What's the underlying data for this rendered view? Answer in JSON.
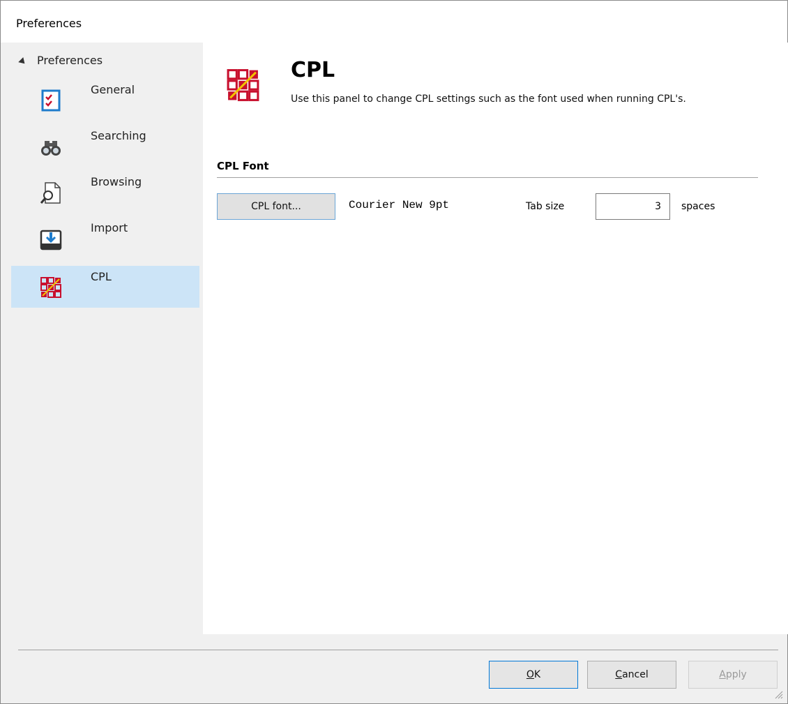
{
  "window": {
    "title": "Preferences"
  },
  "sidebar": {
    "root_label": "Preferences",
    "items": [
      {
        "label": "General",
        "icon": "checklist-icon"
      },
      {
        "label": "Searching",
        "icon": "binoculars-icon"
      },
      {
        "label": "Browsing",
        "icon": "document-magnifier-icon"
      },
      {
        "label": "Import",
        "icon": "import-tray-icon"
      },
      {
        "label": "CPL",
        "icon": "cpl-grid-icon",
        "selected": true
      }
    ]
  },
  "panel": {
    "title": "CPL",
    "description": "Use this panel to change CPL settings such as the font used when running CPL's.",
    "section_title": "CPL Font",
    "font_button_label": "CPL font...",
    "font_value": "Courier New 9pt",
    "tab_size_label": "Tab size",
    "tab_size_value": "3",
    "tab_size_unit": "spaces"
  },
  "footer": {
    "ok_mnemonic": "O",
    "ok_rest": "K",
    "cancel_mnemonic": "C",
    "cancel_rest": "ancel",
    "apply_mnemonic": "A",
    "apply_rest": "pply"
  },
  "colors": {
    "selection": "#cce4f7",
    "accent": "#0078d7",
    "cpl_red": "#c8102e"
  }
}
